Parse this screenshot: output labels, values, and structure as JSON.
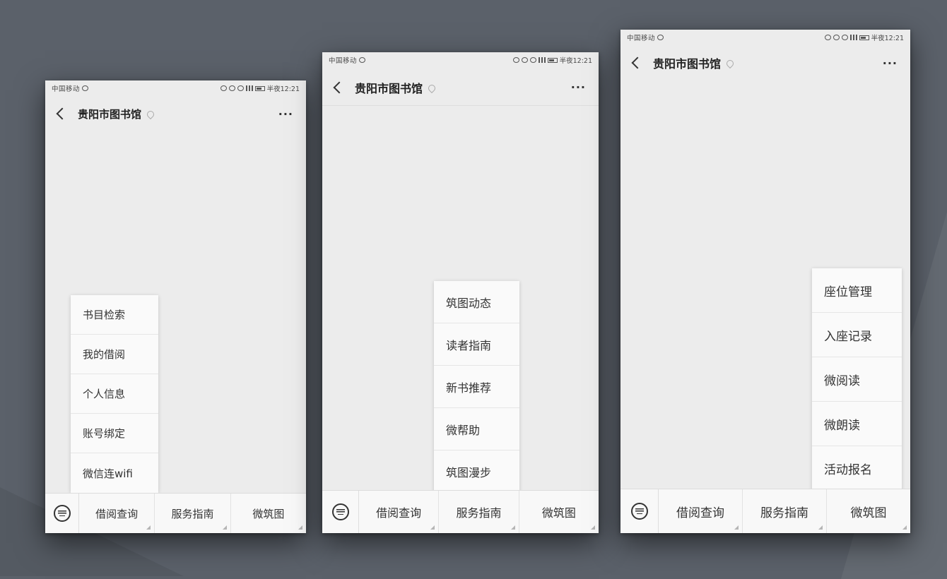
{
  "app": {
    "title": "贵阳市图书馆"
  },
  "phones": [
    {
      "status": {
        "carrier": "中国移动",
        "time": "半夜12:21"
      },
      "nav": {
        "title": "贵阳市图书馆"
      },
      "menu": [
        "借阅查询",
        "服务指南",
        "微筑图"
      ],
      "submenu": [
        "书目检索",
        "我的借阅",
        "个人信息",
        "账号绑定",
        "微信连wifi"
      ]
    },
    {
      "status": {
        "carrier": "中国移动",
        "time": "半夜12:21"
      },
      "nav": {
        "title": "贵阳市图书馆"
      },
      "menu": [
        "借阅查询",
        "服务指南",
        "微筑图"
      ],
      "submenu": [
        "筑图动态",
        "读者指南",
        "新书推荐",
        "微帮助",
        "筑图漫步"
      ]
    },
    {
      "status": {
        "carrier": "中国移动",
        "time": "半夜12:21"
      },
      "nav": {
        "title": "贵阳市图书馆"
      },
      "menu": [
        "借阅查询",
        "服务指南",
        "微筑图"
      ],
      "submenu": [
        "座位管理",
        "入座记录",
        "微阅读",
        "微朗读",
        "活动报名"
      ]
    }
  ],
  "icons": {
    "back": "chevron-left-icon",
    "pin": "location-pin-icon",
    "more": "more-dots-icon",
    "keyboard": "keyboard-icon"
  },
  "colors": {
    "background": "#5b616a",
    "screen": "#ececec",
    "menu": "#f8f8f8",
    "text": "#333333"
  }
}
